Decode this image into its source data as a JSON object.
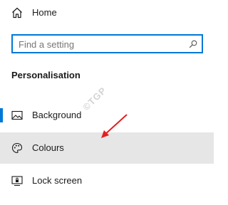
{
  "home": {
    "label": "Home",
    "icon": "home-icon"
  },
  "search": {
    "placeholder": "Find a setting",
    "value": "",
    "icon": "search-icon"
  },
  "section": {
    "title": "Personalisation"
  },
  "nav": {
    "items": [
      {
        "label": "Background",
        "icon": "image-icon"
      },
      {
        "label": "Colours",
        "icon": "palette-icon"
      },
      {
        "label": "Lock screen",
        "icon": "lock-screen-icon"
      }
    ]
  },
  "watermark": {
    "text": "©TGP"
  },
  "colors": {
    "accent": "#0078d7",
    "hover_background": "#e6e6e6",
    "annotation_arrow": "#e02020"
  }
}
